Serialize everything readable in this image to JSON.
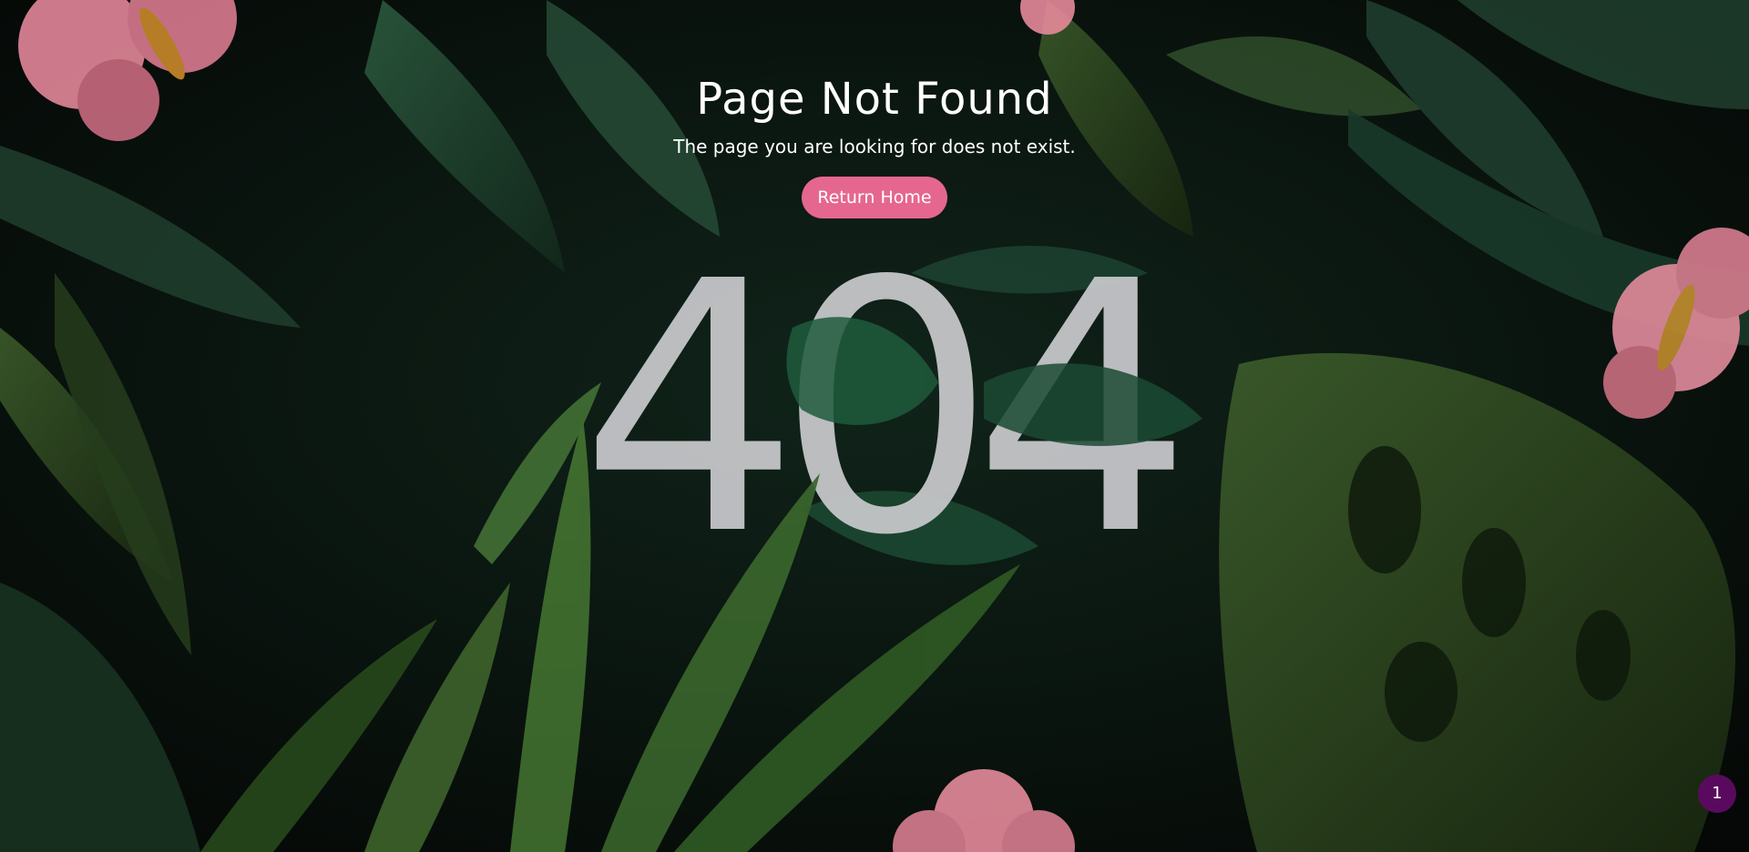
{
  "page": {
    "title": "Page Not Found",
    "message": "The page you are looking for does not exist.",
    "return_button_label": "Return Home",
    "error_code": "404",
    "badge_count": "1"
  },
  "colors": {
    "button": "#e5678f",
    "badge": "#5a0a5e",
    "foliage_dark": "#0a120c",
    "foliage_green": "#1f4a33",
    "flower_pink": "#e78d9a"
  },
  "background": {
    "icons": [
      "monstera-leaf-icon",
      "palm-frond-icon",
      "hibiscus-flower-icon"
    ]
  }
}
